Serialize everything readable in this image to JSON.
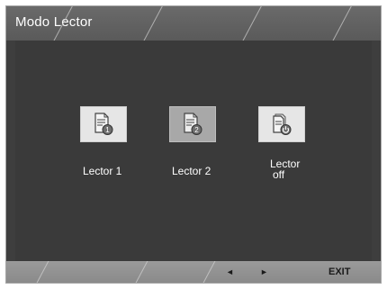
{
  "title": "Modo Lector",
  "modes": [
    {
      "label": "Lector 1",
      "badge": "1",
      "selected": false,
      "icon": "document-badge-1-icon"
    },
    {
      "label": "Lector 2",
      "badge": "2",
      "selected": true,
      "icon": "document-badge-2-icon"
    },
    {
      "label_line1": "Lector",
      "label_line2": "off",
      "selected": false,
      "icon": "document-power-icon"
    }
  ],
  "footer": {
    "left_arrow": "◄",
    "right_arrow": "►",
    "exit_label": "EXIT"
  },
  "colors": {
    "osd_background": "#3e3e3e",
    "title_bar": "#5a5a5a",
    "bottom_bar": "#8a8a8a",
    "icon_tile": "#e6e6e6",
    "icon_tile_selected": "#a8a8a8"
  }
}
